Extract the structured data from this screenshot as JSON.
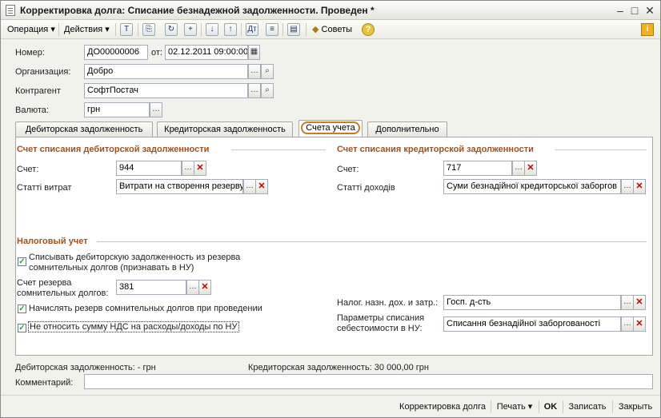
{
  "window": {
    "title": "Корректировка долга: Списание безнадежной задолженности. Проведен *"
  },
  "toolbar": {
    "operation": "Операция",
    "actions": "Действия",
    "tips": "Советы"
  },
  "header": {
    "number_label": "Номер:",
    "number_value": "ДО00000006",
    "date_label": "от:",
    "date_value": "02.12.2011 09:00:00",
    "org_label": "Организация:",
    "org_value": "Добро",
    "contractor_label": "Контрагент",
    "contractor_value": "СофтПостач",
    "currency_label": "Валюта:",
    "currency_value": "грн"
  },
  "tabs": [
    {
      "label": "Дебиторская задолженность"
    },
    {
      "label": "Кредиторская задолженность"
    },
    {
      "label": "Счета учета"
    },
    {
      "label": "Дополнительно"
    }
  ],
  "debit": {
    "title": "Счет списания дебиторской задолженности",
    "account_label": "Счет:",
    "account_value": "944",
    "expense_label": "Статті витрат",
    "expense_value": "Витрати на створення резерву"
  },
  "credit": {
    "title": "Счет списания кредиторской задолженности",
    "account_label": "Счет:",
    "account_value": "717",
    "income_label": "Статті доходів",
    "income_value": "Суми безнадійної кредиторської заборгов"
  },
  "tax": {
    "title": "Налоговый учет",
    "cb1_line1": "Списывать дебиторскую задолженность из резерва",
    "cb1_line2": "сомнительных долгов (признавать в НУ)",
    "reserve_label_line1": "Счет резерва",
    "reserve_label_line2": "сомнительных долгов:",
    "reserve_value": "381",
    "cb2": "Начислять резерв сомнительных долгов при проведении",
    "cb3": "Не относить сумму НДС на расходы/доходы по НУ",
    "purpose_label": "Налог. назн. дох. и затр.:",
    "purpose_value": "Госп. д-сть",
    "params_label_line1": "Параметры списания",
    "params_label_line2": "себестоимости в НУ:",
    "params_value": "Списання безнадійної заборгованості"
  },
  "summary": {
    "debit": "Дебиторская задолженность: - грн",
    "credit": "Кредиторская задолженность: 30 000,00 грн",
    "comment_label": "Комментарий:"
  },
  "footer": {
    "correction": "Корректировка долга",
    "print": "Печать",
    "ok": "OK",
    "save": "Записать",
    "close": "Закрыть"
  }
}
